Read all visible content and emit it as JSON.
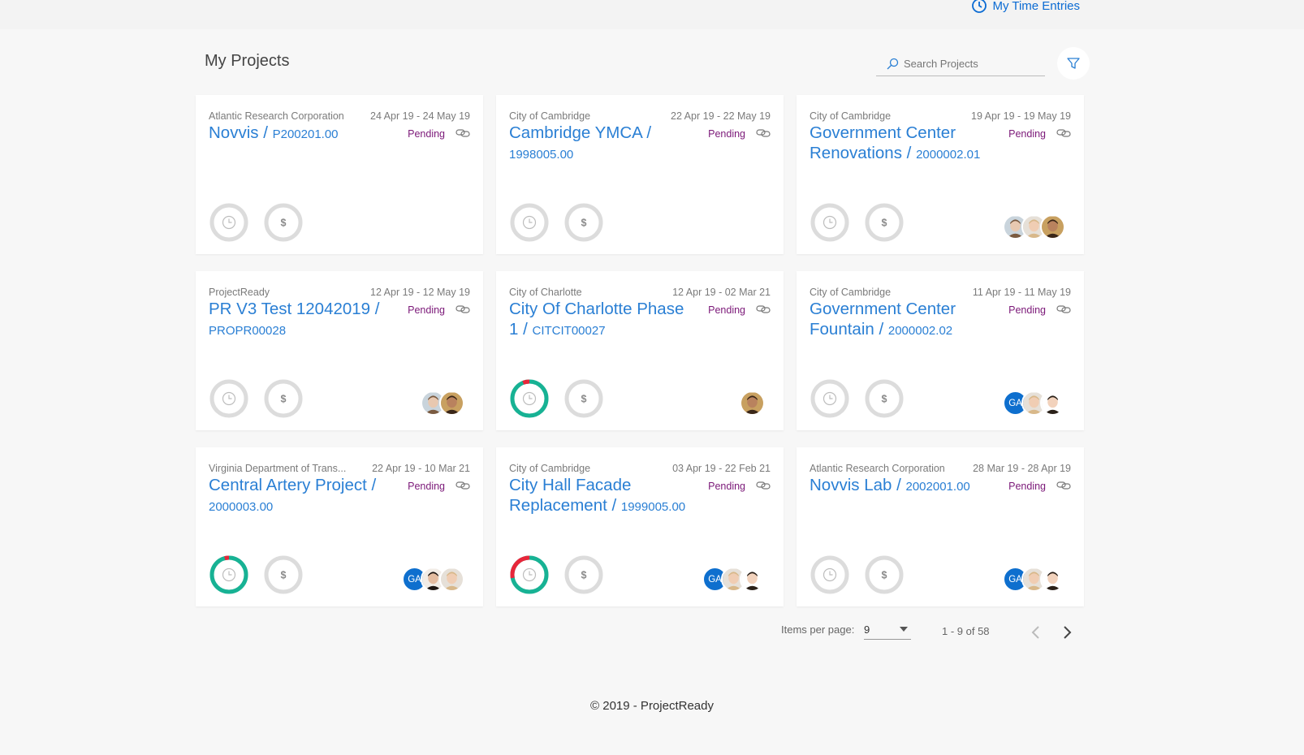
{
  "header": {
    "time_entries_label": "My Time Entries"
  },
  "page": {
    "title": "My Projects",
    "search_placeholder": "Search Projects"
  },
  "projects": [
    {
      "client": "Atlantic Research Corporation",
      "dates": "24 Apr 19 - 24 May 19",
      "name": "Novvis / ",
      "code": "P200201.00",
      "status": "Pending",
      "time_progress": 0,
      "overrun": 0,
      "avatars": []
    },
    {
      "client": "City of Cambridge",
      "dates": "22 Apr 19 - 22 May 19",
      "name": "Cambridge YMCA / ",
      "code": "1998005.00",
      "status": "Pending",
      "time_progress": 0,
      "overrun": 0,
      "avatars": []
    },
    {
      "client": "City of Cambridge",
      "dates": "19 Apr 19 - 19 May 19",
      "name": "Government Center Renovations / ",
      "code": "2000002.01",
      "status": "Pending",
      "time_progress": 0,
      "overrun": 0,
      "avatars": [
        "person-1",
        "person-2",
        "person-3"
      ]
    },
    {
      "client": "ProjectReady",
      "dates": "12 Apr 19 - 12 May 19",
      "name": "PR V3 Test 12042019 / ",
      "code": "PROPR00028",
      "status": "Pending",
      "time_progress": 0,
      "overrun": 0,
      "avatars": [
        "person-1",
        "person-3"
      ]
    },
    {
      "client": "City of Charlotte",
      "dates": "12 Apr 19 - 02 Mar 21",
      "name": "City Of Charlotte Phase 1 / ",
      "code": "CITCIT00027",
      "status": "Pending",
      "time_progress": 1,
      "overrun": 0.06,
      "avatars": [
        "person-3"
      ]
    },
    {
      "client": "City of Cambridge",
      "dates": "11 Apr 19 - 11 May 19",
      "name": "Government Center Fountain / ",
      "code": "2000002.02",
      "status": "Pending",
      "time_progress": 0,
      "overrun": 0,
      "avatars": [
        "GA",
        "person-2",
        "person-4"
      ]
    },
    {
      "client": "Virginia Department of Trans...",
      "dates": "22 Apr 19 - 10 Mar 21",
      "name": "Central Artery Project / ",
      "code": "2000003.00",
      "status": "Pending",
      "time_progress": 1,
      "overrun": 0.04,
      "avatars": [
        "GA",
        "person-5",
        "person-2"
      ]
    },
    {
      "client": "City of Cambridge",
      "dates": "03 Apr 19 - 22 Feb 21",
      "name": "City Hall Facade Replacement / ",
      "code": "1999005.00",
      "status": "Pending",
      "time_progress": 1,
      "overrun": 0.28,
      "avatars": [
        "GA",
        "person-2",
        "person-4"
      ]
    },
    {
      "client": "Atlantic Research Corporation",
      "dates": "28 Mar 19 - 28 Apr 19",
      "name": "Novvis Lab / ",
      "code": "2002001.00",
      "status": "Pending",
      "time_progress": 0,
      "overrun": 0,
      "avatars": [
        "GA",
        "person-2",
        "person-4"
      ]
    }
  ],
  "pager": {
    "items_per_page_label": "Items per page:",
    "items_per_page_value": "9",
    "range_label": "1 - 9 of 58"
  },
  "footer": {
    "text": "© 2019 - ProjectReady"
  },
  "colors": {
    "accent": "#2a7fd4",
    "status": "#7b1878",
    "progress": "#17b294",
    "overrun": "#e8263a",
    "ring_empty": "#dcdcdc",
    "avatar_ga": "#0e6fce"
  },
  "icons": {
    "time": "clock-icon",
    "cost": "dollar-icon",
    "link": "link-icon",
    "search": "search-icon",
    "filter": "filter-icon"
  }
}
